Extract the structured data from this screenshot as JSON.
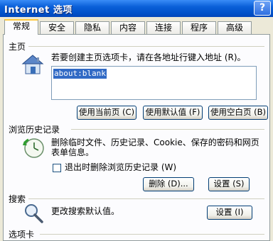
{
  "window": {
    "title": "Internet 选项",
    "help_glyph": "?"
  },
  "tabs": [
    {
      "label": "常规",
      "active": true
    },
    {
      "label": "安全",
      "active": false
    },
    {
      "label": "隐私",
      "active": false
    },
    {
      "label": "内容",
      "active": false
    },
    {
      "label": "连接",
      "active": false
    },
    {
      "label": "程序",
      "active": false
    },
    {
      "label": "高级",
      "active": false
    }
  ],
  "home_page": {
    "section_label": "主页",
    "description": "若要创建主页选项卡，请在各地址行键入地址 (R)。",
    "address_value": "about:blank",
    "buttons": {
      "use_current": "使用当前页 (C)",
      "use_default": "使用默认值 (F)",
      "use_blank": "使用空白页 (B)"
    }
  },
  "history": {
    "section_label": "浏览历史记录",
    "description_line1": "删除临时文件、历史记录、Cookie、保存的密码和网页",
    "description_line2": "表单信息。",
    "checkbox_label": "退出时删除浏览历史记录 (W)",
    "checkbox_checked": false,
    "buttons": {
      "delete": "删除 (D)...",
      "settings": "设置 (S)"
    }
  },
  "search": {
    "section_label": "搜索",
    "description": "更改搜索默认值。",
    "buttons": {
      "settings": "设置 (I)"
    }
  },
  "tabs_section": {
    "section_label": "选项卡"
  },
  "colors": {
    "title_bar": "#0050c8",
    "dialog_bg": "#ece9d8",
    "selection": "#316ac5",
    "active_tab_accent": "#ffc83c"
  }
}
